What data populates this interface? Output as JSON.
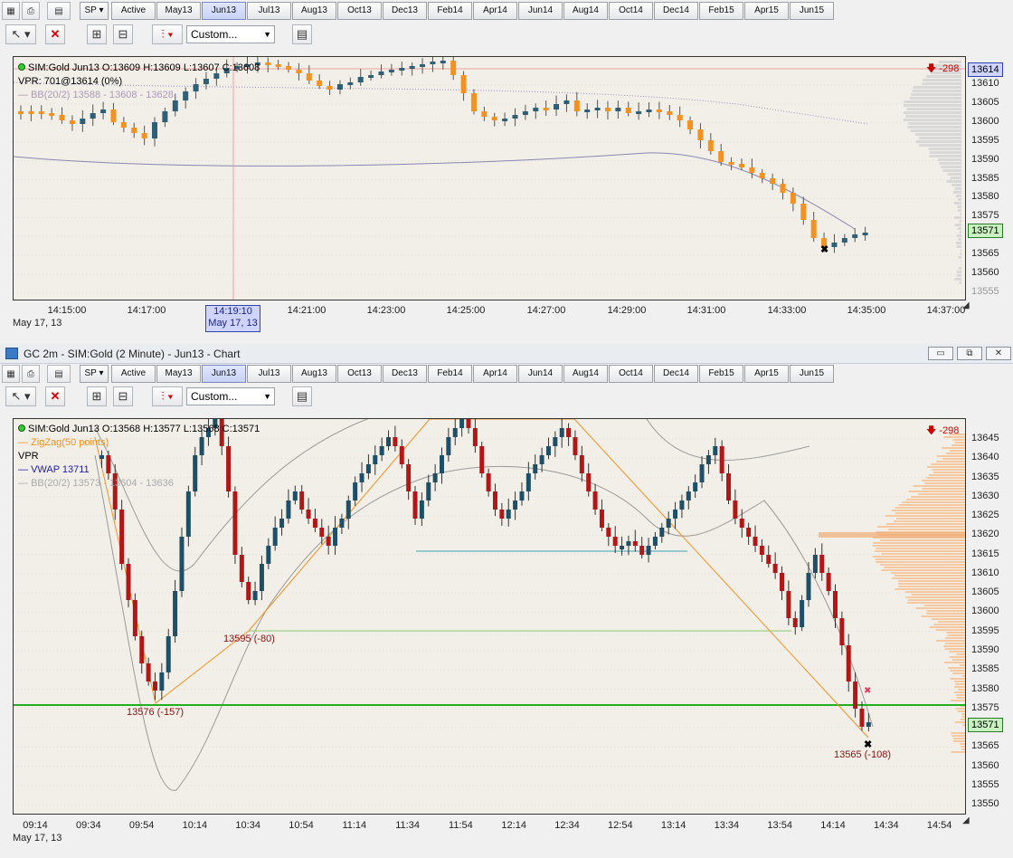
{
  "top_toolbar": {
    "instrument": "SP",
    "contracts": [
      "Active",
      "May13",
      "Jun13",
      "Jul13",
      "Aug13",
      "Oct13",
      "Dec13",
      "Feb14",
      "Apr14",
      "Jun14",
      "Aug14",
      "Oct14",
      "Dec14",
      "Feb15",
      "Apr15",
      "Jun15"
    ],
    "selected": "Jun13",
    "template": "Custom..."
  },
  "top_chart": {
    "info_line": "SIM:Gold Jun13 O:13609 H:13609 L:13607 C:13608",
    "vpr_line": "VPR: 701@13614 (0%)",
    "bb_line": "BB(20/2) 13588 - 13608 - 13628",
    "pnl": "-298",
    "last_price": "13614",
    "last_price2": "13571",
    "y_labels": [
      "13610",
      "13605",
      "13600",
      "13595",
      "13590",
      "13585",
      "13580",
      "13575",
      "13570",
      "13565",
      "13560",
      "13555"
    ],
    "x_labels": [
      "14:15:00",
      "14:17:00",
      "14:21:00",
      "14:23:00",
      "14:25:00",
      "14:27:00",
      "14:29:00",
      "14:31:00",
      "14:33:00",
      "14:35:00",
      "14:37:00"
    ],
    "cursor_time": "14:19:10",
    "cursor_date": "May 17, 13",
    "date_label": "May 17, 13"
  },
  "window": {
    "title": "GC 2m - SIM:Gold (2 Minute) - Jun13 - Chart",
    "minimize": "▭",
    "restore": "⧉",
    "close": "✕"
  },
  "bottom_toolbar": {
    "instrument": "SP",
    "contracts": [
      "Active",
      "May13",
      "Jun13",
      "Jul13",
      "Aug13",
      "Oct13",
      "Dec13",
      "Feb14",
      "Apr14",
      "Jun14",
      "Aug14",
      "Oct14",
      "Dec14",
      "Feb15",
      "Apr15",
      "Jun15"
    ],
    "selected": "Jun13",
    "template": "Custom..."
  },
  "bottom_chart": {
    "info_line": "SIM:Gold Jun13 O:13568 H:13577 L:13568 C:13571",
    "zigzag_line": "ZigZag(50 points)",
    "vpr_line": "VPR",
    "vwap_line": "VWAP 13711",
    "bb_line": "BB(20/2) 13573 - 13604 - 13636",
    "pnl": "-298",
    "last_price": "13571",
    "y_labels": [
      "13645",
      "13640",
      "13635",
      "13630",
      "13625",
      "13620",
      "13615",
      "13610",
      "13605",
      "13600",
      "13595",
      "13590",
      "13585",
      "13580",
      "13575",
      "13570",
      "13565",
      "13560",
      "13555",
      "13550"
    ],
    "x_labels": [
      "09:14",
      "09:34",
      "09:54",
      "10:14",
      "10:34",
      "10:54",
      "11:14",
      "11:34",
      "11:54",
      "12:14",
      "12:34",
      "12:54",
      "13:14",
      "13:34",
      "13:54",
      "14:14",
      "14:34",
      "14:54"
    ],
    "date_label": "May 17, 13",
    "swing_labels": [
      "13576 (-157)",
      "13595 (-80)",
      "13565 (-108)"
    ]
  },
  "colors": {
    "up_candle": "#2e5f77",
    "down_candle": "#f39220",
    "down_candle_bottom": "#b01818",
    "up_candle_bottom": "#1f4f66",
    "green_line": "#22b022",
    "zigzag": "#f39220",
    "bb": "#9a9a9a",
    "vwap": "#5a5a9a",
    "volume_profile": "#f5c8a0"
  }
}
